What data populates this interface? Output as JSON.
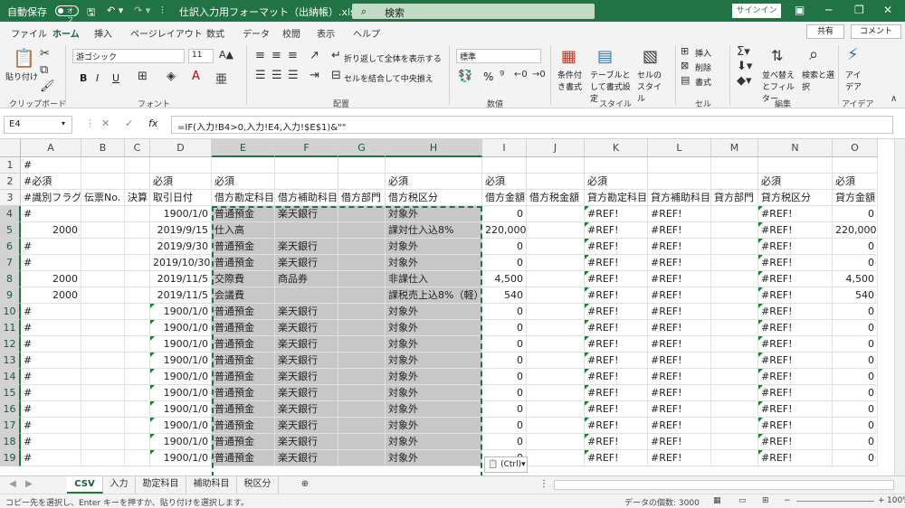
{
  "titlebar": {
    "autosave": "自動保存",
    "toggle": "オフ",
    "filename": "仕訳入力用フォーマット（出納帳）.xlsx - Ex···",
    "search": "検索",
    "signin": "サインイン"
  },
  "tabs": {
    "items": [
      "ファイル",
      "ホーム",
      "挿入",
      "ページレイアウト",
      "数式",
      "データ",
      "校閲",
      "表示",
      "ヘルプ"
    ],
    "share": "共有",
    "comment": "コメント"
  },
  "ribbon": {
    "paste": "貼り付け",
    "clipboard": "クリップボード",
    "font_name": "游ゴシック",
    "font_size": "11",
    "font": "フォント",
    "wrap": "折り返して全体を表示する",
    "merge": "セルを結合して中央揃え",
    "alignment": "配置",
    "number_format": "標準",
    "number": "数値",
    "cond": "条件付き書式",
    "table": "テーブルとして書式設定",
    "cellstyle": "セルのスタイル",
    "styles": "スタイル",
    "insert": "挿入",
    "delete": "削除",
    "format": "書式",
    "cells": "セル",
    "sort": "並べ替えとフィルター",
    "find": "検索と選択",
    "editing": "編集",
    "ideas": "アイデア",
    "ideas_group": "アイデア",
    "bold": "B",
    "italic": "I",
    "underline": "U",
    "percent": "%"
  },
  "formula_bar": {
    "name_box": "E4",
    "fx": "fx",
    "formula": "=IF(入力!B4>0,入力!E4,入力!$E$1)&\"\""
  },
  "grid": {
    "columns": [
      "A",
      "B",
      "C",
      "D",
      "E",
      "F",
      "G",
      "H",
      "I",
      "J",
      "K",
      "L",
      "M",
      "N",
      "O"
    ],
    "rows": [
      [
        "1",
        "#",
        "",
        "",
        "",
        "",
        "",
        "",
        "",
        "",
        "",
        "",
        "",
        "",
        "",
        ""
      ],
      [
        "2",
        "#必須",
        "",
        "",
        "必須",
        "必須",
        "",
        "",
        "必須",
        "必須",
        "",
        "必須",
        "",
        "",
        "必須",
        "必須"
      ],
      [
        "3",
        "#識別フラグ",
        "伝票No.",
        "決算",
        "取引日付",
        "借方勘定科目",
        "借方補助科目",
        "借方部門",
        "借方税区分",
        "借方金額",
        "借方税金額",
        "貸方勘定科目",
        "貸方補助科目",
        "貸方部門",
        "貸方税区分",
        "貸方金額"
      ],
      [
        "4",
        "#",
        "",
        "",
        "1900/1/0",
        "普通預金",
        "楽天銀行",
        "",
        "対象外",
        "0",
        "",
        "#REF!",
        "#REF!",
        "",
        "#REF!",
        "0"
      ],
      [
        "5",
        "2000",
        "",
        "",
        "2019/9/15",
        "仕入高",
        "",
        "",
        "課対仕入込8%",
        "220,000",
        "",
        "#REF!",
        "#REF!",
        "",
        "#REF!",
        "220,000"
      ],
      [
        "6",
        "#",
        "",
        "",
        "2019/9/30",
        "普通預金",
        "楽天銀行",
        "",
        "対象外",
        "0",
        "",
        "#REF!",
        "#REF!",
        "",
        "#REF!",
        "0"
      ],
      [
        "7",
        "#",
        "",
        "",
        "2019/10/30",
        "普通預金",
        "楽天銀行",
        "",
        "対象外",
        "0",
        "",
        "#REF!",
        "#REF!",
        "",
        "#REF!",
        "0"
      ],
      [
        "8",
        "2000",
        "",
        "",
        "2019/11/5",
        "交際費",
        "商品券",
        "",
        "非課仕入",
        "4,500",
        "",
        "#REF!",
        "#REF!",
        "",
        "#REF!",
        "4,500"
      ],
      [
        "9",
        "2000",
        "",
        "",
        "2019/11/5",
        "会議費",
        "",
        "",
        "課税売上込8%（軽）",
        "540",
        "",
        "#REF!",
        "#REF!",
        "",
        "#REF!",
        "540"
      ],
      [
        "10",
        "#",
        "",
        "",
        "1900/1/0",
        "普通預金",
        "楽天銀行",
        "",
        "対象外",
        "0",
        "",
        "#REF!",
        "#REF!",
        "",
        "#REF!",
        "0"
      ],
      [
        "11",
        "#",
        "",
        "",
        "1900/1/0",
        "普通預金",
        "楽天銀行",
        "",
        "対象外",
        "0",
        "",
        "#REF!",
        "#REF!",
        "",
        "#REF!",
        "0"
      ],
      [
        "12",
        "#",
        "",
        "",
        "1900/1/0",
        "普通預金",
        "楽天銀行",
        "",
        "対象外",
        "0",
        "",
        "#REF!",
        "#REF!",
        "",
        "#REF!",
        "0"
      ],
      [
        "13",
        "#",
        "",
        "",
        "1900/1/0",
        "普通預金",
        "楽天銀行",
        "",
        "対象外",
        "0",
        "",
        "#REF!",
        "#REF!",
        "",
        "#REF!",
        "0"
      ],
      [
        "14",
        "#",
        "",
        "",
        "1900/1/0",
        "普通預金",
        "楽天銀行",
        "",
        "対象外",
        "0",
        "",
        "#REF!",
        "#REF!",
        "",
        "#REF!",
        "0"
      ],
      [
        "15",
        "#",
        "",
        "",
        "1900/1/0",
        "普通預金",
        "楽天銀行",
        "",
        "対象外",
        "0",
        "",
        "#REF!",
        "#REF!",
        "",
        "#REF!",
        "0"
      ],
      [
        "16",
        "#",
        "",
        "",
        "1900/1/0",
        "普通預金",
        "楽天銀行",
        "",
        "対象外",
        "0",
        "",
        "#REF!",
        "#REF!",
        "",
        "#REF!",
        "0"
      ],
      [
        "17",
        "#",
        "",
        "",
        "1900/1/0",
        "普通預金",
        "楽天銀行",
        "",
        "対象外",
        "0",
        "",
        "#REF!",
        "#REF!",
        "",
        "#REF!",
        "0"
      ],
      [
        "18",
        "#",
        "",
        "",
        "1900/1/0",
        "普通預金",
        "楽天銀行",
        "",
        "対象外",
        "0",
        "",
        "#REF!",
        "#REF!",
        "",
        "#REF!",
        "0"
      ],
      [
        "19",
        "#",
        "",
        "",
        "1900/1/0",
        "普通預金",
        "楽天銀行",
        "",
        "対象外",
        "0",
        "",
        "#REF!",
        "#REF!",
        "",
        "#REF!",
        "0"
      ]
    ],
    "paste_options": "(Ctrl)"
  },
  "sheets": [
    "CSV",
    "入力",
    "勘定科目",
    "補助科目",
    "税区分"
  ],
  "status": {
    "left": "コピー先を選択し、Enter キーを押すか、貼り付けを選択します。",
    "count": "データの個数: 3000",
    "zoom": "100%"
  },
  "colors": {
    "accent": "#217346",
    "selection": "#c7c7c7"
  }
}
